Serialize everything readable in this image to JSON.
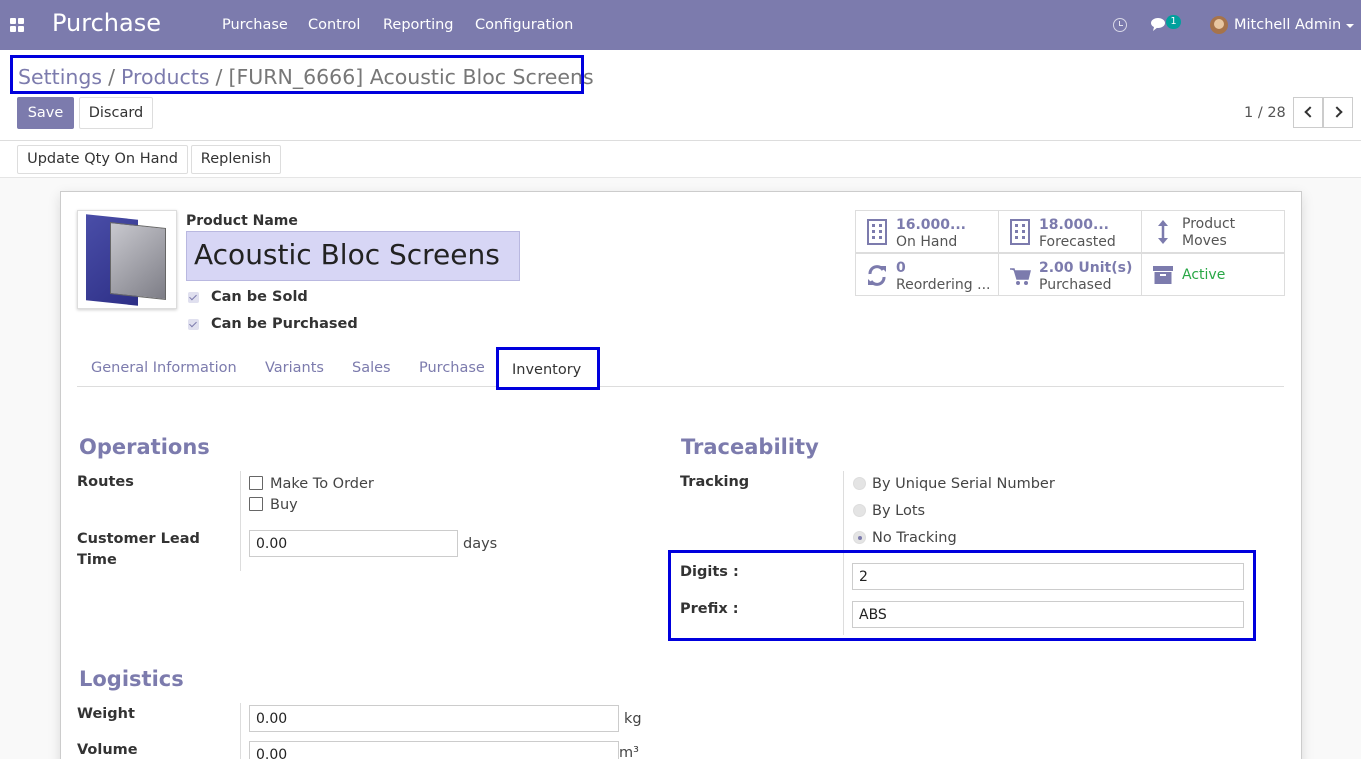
{
  "navbar": {
    "app_title": "Purchase",
    "menu": [
      "Purchase",
      "Control",
      "Reporting",
      "Configuration"
    ],
    "chat_badge": "1",
    "user_name": "Mitchell Admin"
  },
  "breadcrumb": {
    "items": [
      "Settings",
      "Products",
      "[FURN_6666] Acoustic Bloc Screens"
    ]
  },
  "actions": {
    "save_label": "Save",
    "discard_label": "Discard",
    "pager": "1 / 28"
  },
  "statusbar": {
    "update_qty_label": "Update Qty On Hand",
    "replenish_label": "Replenish"
  },
  "product": {
    "name_label": "Product Name",
    "name": "Acoustic Bloc Screens",
    "can_be_sold_label": "Can be Sold",
    "can_be_purchased_label": "Can be Purchased"
  },
  "smart_buttons": {
    "on_hand_value": "16.000...",
    "on_hand_label": "On Hand",
    "forecasted_value": "18.000...",
    "forecasted_label": "Forecasted",
    "product_moves_label_1": "Product",
    "product_moves_label_2": "Moves",
    "reordering_value": "0",
    "reordering_label": "Reordering ...",
    "purchased_value": "2.00",
    "purchased_unit": "Unit(s)",
    "purchased_label": "Purchased",
    "active_label": "Active"
  },
  "tabs": [
    "General Information",
    "Variants",
    "Sales",
    "Purchase",
    "Inventory"
  ],
  "operations": {
    "title": "Operations",
    "routes_label": "Routes",
    "routes": [
      "Make To Order",
      "Buy"
    ],
    "lead_time_label_1": "Customer Lead",
    "lead_time_label_2": "Time",
    "lead_time_value": "0.00",
    "lead_time_unit": "days"
  },
  "traceability": {
    "title": "Traceability",
    "tracking_label": "Tracking",
    "options": [
      "By Unique Serial Number",
      "By Lots",
      "No Tracking"
    ],
    "selected": "No Tracking",
    "digits_label": "Digits :",
    "digits_value": "2",
    "prefix_label": "Prefix :",
    "prefix_value": "ABS"
  },
  "logistics": {
    "title": "Logistics",
    "weight_label": "Weight",
    "weight_value": "0.00",
    "weight_unit": "kg",
    "volume_label": "Volume",
    "volume_value": "0.00",
    "volume_unit": "m³"
  },
  "colors": {
    "brand": "#7c7bad",
    "highlight": "#0000dd",
    "active_green": "#28a745"
  }
}
